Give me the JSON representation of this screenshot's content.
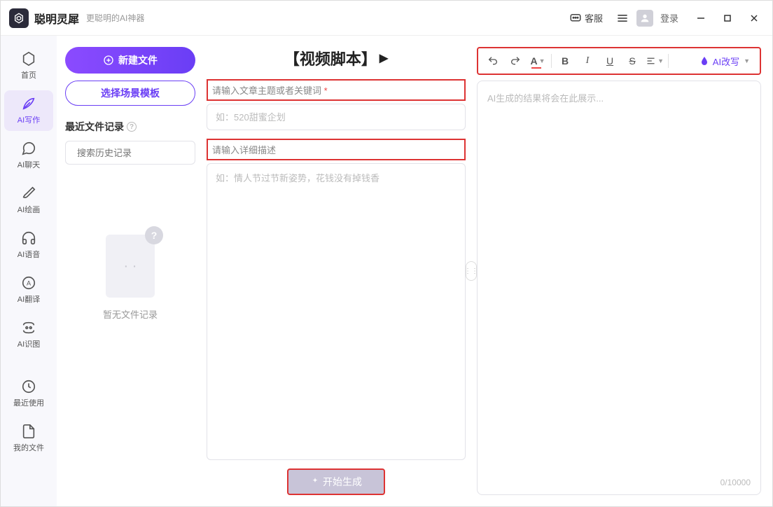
{
  "app": {
    "title": "聪明灵犀",
    "subtitle": "更聪明的AI神器"
  },
  "titlebar": {
    "service": "客服",
    "login": "登录"
  },
  "sidenav": {
    "items": [
      {
        "label": "首页"
      },
      {
        "label": "AI写作"
      },
      {
        "label": "AI聊天"
      },
      {
        "label": "AI绘画"
      },
      {
        "label": "AI语音"
      },
      {
        "label": "AI翻译"
      },
      {
        "label": "AI识图"
      },
      {
        "label": "最近使用"
      },
      {
        "label": "我的文件"
      }
    ]
  },
  "filepanel": {
    "new_file": "新建文件",
    "choose_template": "选择场景模板",
    "recent_title": "最近文件记录",
    "search_placeholder": "搜索历史记录",
    "empty_text": "暂无文件记录"
  },
  "center": {
    "page_title": "【视频脚本】",
    "label_topic": "请输入文章主题或者关键词",
    "placeholder_topic": "如：520甜蜜企划",
    "label_detail": "请输入详细描述",
    "placeholder_detail": "如：情人节过节新姿势，花钱没有掉钱香",
    "generate": "开始生成"
  },
  "right": {
    "ai_rewrite": "AI改写",
    "output_placeholder": "AI生成的结果将会在此展示...",
    "char_count": "0/10000"
  }
}
